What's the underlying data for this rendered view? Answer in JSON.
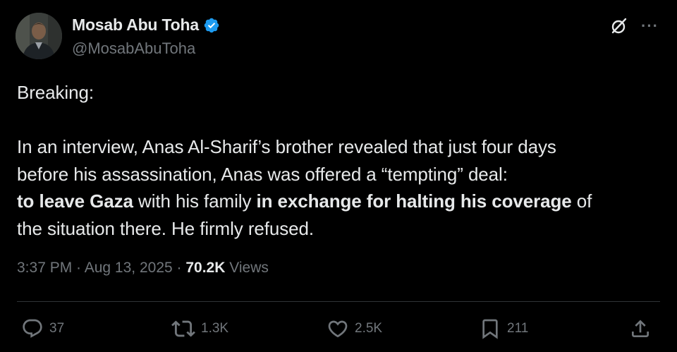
{
  "author": {
    "display_name": "Mosab Abu Toha",
    "handle": "@MosabAbuToha",
    "verified": true
  },
  "icons": {
    "avatar": "avatar-photo",
    "verified": "verified-badge-icon",
    "grok": "grok-icon",
    "more": "more-options-icon"
  },
  "tweet": {
    "line_breaking": "Breaking:",
    "line_1": "In an interview, Anas Al-Sharif’s brother revealed that just four days",
    "line_2": "before his assassination, Anas was offered a “tempting” deal:",
    "bold_1": "to leave Gaza",
    "mid_1": " with his family ",
    "bold_2": "in exchange for halting his coverage",
    "end_1": " of",
    "line_4": "the situation there. He firmly refused."
  },
  "meta": {
    "time": "3:37 PM",
    "sep1": " · ",
    "date": "Aug 13, 2025",
    "sep2": " · ",
    "views_count": "70.2K",
    "views_label": " Views"
  },
  "actions": {
    "replies": "37",
    "reposts": "1.3K",
    "likes": "2.5K",
    "bookmarks": "211"
  },
  "colors": {
    "background": "#000000",
    "text": "#e7e9ea",
    "muted": "#71767b",
    "verified": "#1d9bf0",
    "divider": "#2f3336"
  }
}
